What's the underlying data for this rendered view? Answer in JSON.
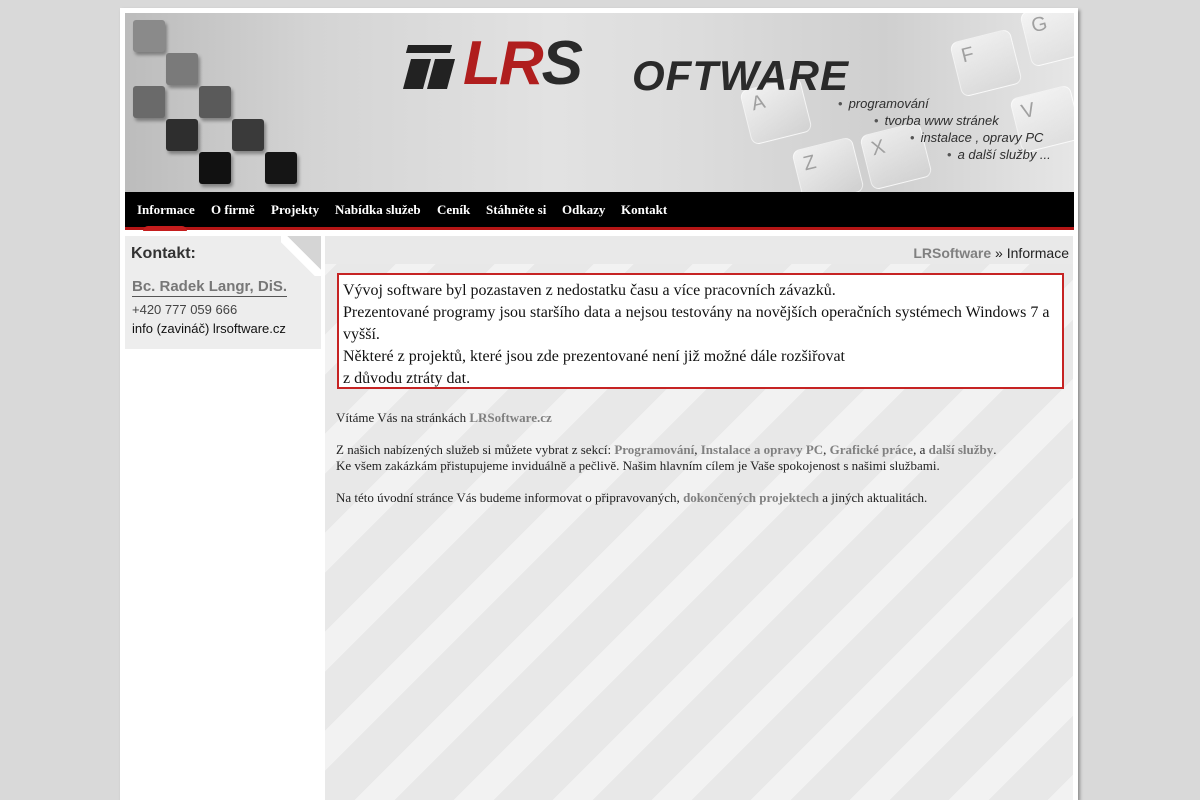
{
  "header": {
    "logo": {
      "lr": "LR",
      "s": "S",
      "rest": "OFTWARE"
    },
    "taglines": [
      "programování",
      "tvorba www stránek",
      "instalace , opravy PC",
      "a další služby ..."
    ],
    "keys": [
      "G",
      "F",
      "A",
      "V",
      "X",
      "Z"
    ]
  },
  "nav": {
    "items": [
      "Informace",
      "O firmě",
      "Projekty",
      "Nabídka služeb",
      "Ceník",
      "Stáhněte si",
      "Odkazy",
      "Kontakt"
    ],
    "active": "Informace"
  },
  "sidebar": {
    "title": "Kontakt:",
    "name": "Bc. Radek Langr, DiS.",
    "phone": "+420 777 059 666",
    "email": "info (zavináč) lrsoftware.cz"
  },
  "breadcrumb": {
    "home": "LRSoftware",
    "separator": " » ",
    "current": "Informace"
  },
  "notice": {
    "lines": [
      "Vývoj software byl pozastaven z nedostatku času a více pracovních závazků.",
      "Prezentované programy jsou staršího data a nejsou testovány na novějších operačních systémech Windows 7 a vyšší.",
      "Některé z projektů, které jsou zde prezentované není již možné dále rozšiřovat",
      "z důvodu ztráty dat."
    ]
  },
  "content": {
    "welcome_text": "Vítáme Vás na stránkách ",
    "welcome_link": "LRSoftware.cz",
    "services_text": "Z našich nabízených služeb si můžete vybrat z sekcí: ",
    "services_links": [
      "Programování",
      "Instalace a opravy PC",
      "Grafické práce",
      "další služby"
    ],
    "comma": ", ",
    "and": ", a ",
    "dot": ".",
    "approach_text": "Ke všem zakázkám přistupujeme inviduálně a pečlivě. Našim hlavním cílem je Vaše spokojenost s našimi službami.",
    "news_text": "Na této úvodní stránce Vás budeme informovat o připravovaných, ",
    "news_link": "dokončených projektech",
    "news_end": " a jiných aktualitách."
  },
  "colors": {
    "accent_red": "#b51515",
    "link_gray": "#808080",
    "nav_bg": "#000000"
  }
}
